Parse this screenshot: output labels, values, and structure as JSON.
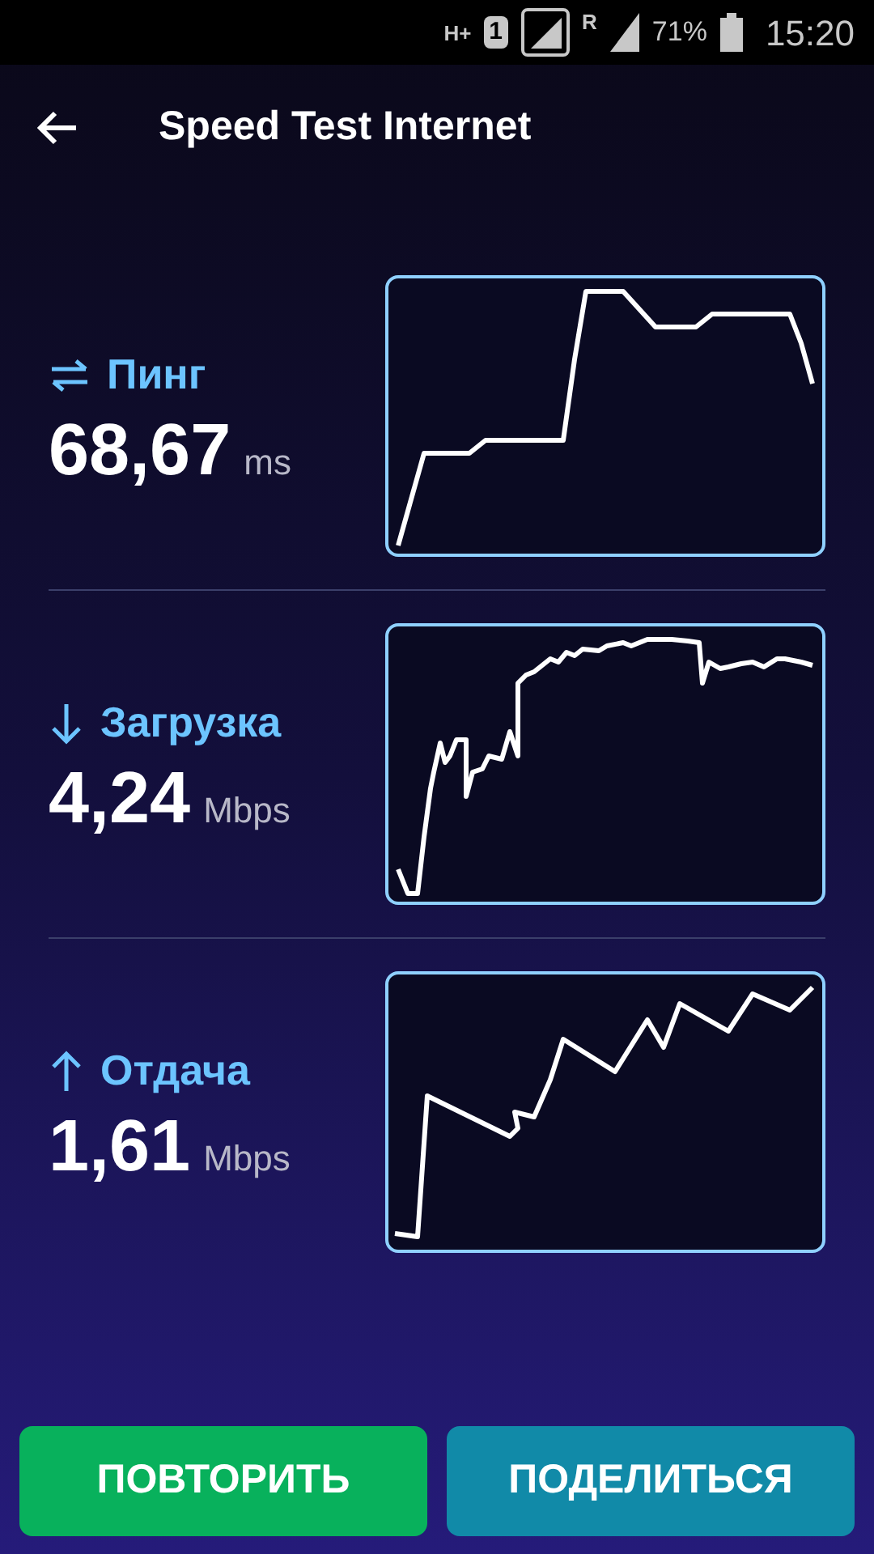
{
  "status_bar": {
    "network": "H+",
    "sim": "1",
    "roaming": "R",
    "battery": "71%",
    "time": "15:20"
  },
  "header": {
    "title": "Speed Test Internet"
  },
  "metrics": [
    {
      "kind": "ping",
      "label": "Пинг",
      "value": "68,67",
      "unit": "ms"
    },
    {
      "kind": "download",
      "label": "Загрузка",
      "value": "4,24",
      "unit": "Mbps"
    },
    {
      "kind": "upload",
      "label": "Отдача",
      "value": "1,61",
      "unit": "Mbps"
    }
  ],
  "buttons": [
    {
      "label": "ПОВТОРИТЬ",
      "kind": "repeat"
    },
    {
      "label": "ПОДЕЛИТЬСЯ",
      "kind": "share"
    }
  ]
}
